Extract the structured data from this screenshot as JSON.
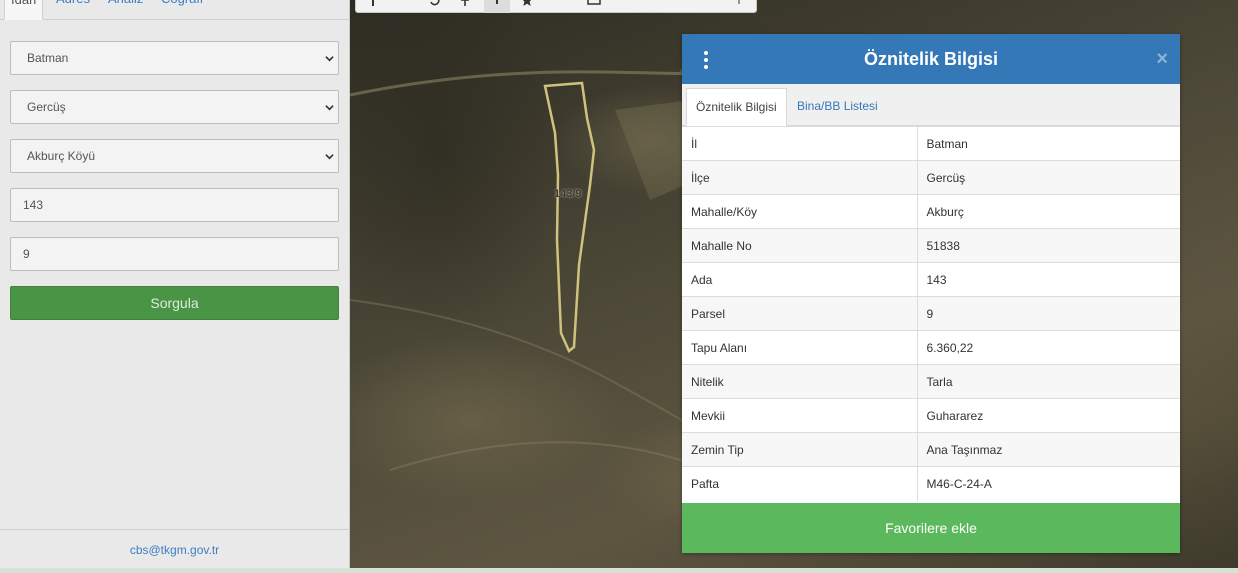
{
  "sidebar": {
    "tabs": [
      {
        "label": "İdari"
      },
      {
        "label": "Adres"
      },
      {
        "label": "Analiz"
      },
      {
        "label": "Coğrafi"
      }
    ],
    "il_select": "Batman",
    "ilce_select": "Gercüş",
    "mahalle_select": "Akburç Köyü",
    "ada_input": "143",
    "parsel_input": "9",
    "query_button": "Sorgula",
    "footer_email": "cbs@tkgm.gov.tr"
  },
  "map": {
    "parcel_label": "143/9",
    "toolbar_icons": [
      "info-icon",
      "refresh-icon",
      "move-icon",
      "pointer-icon",
      "star-icon",
      "separator",
      "print-icon",
      "coordinate-icon",
      "more-icon"
    ]
  },
  "popup": {
    "title": "Öznitelik Bilgisi",
    "tabs": [
      {
        "label": "Öznitelik Bilgisi"
      },
      {
        "label": "Bina/BB Listesi"
      }
    ],
    "rows": [
      {
        "key": "İl",
        "value": "Batman"
      },
      {
        "key": "İlçe",
        "value": "Gercüş"
      },
      {
        "key": "Mahalle/Köy",
        "value": "Akburç"
      },
      {
        "key": "Mahalle No",
        "value": "51838"
      },
      {
        "key": "Ada",
        "value": "143"
      },
      {
        "key": "Parsel",
        "value": "9"
      },
      {
        "key": "Tapu Alanı",
        "value": "6.360,22"
      },
      {
        "key": "Nitelik",
        "value": "Tarla"
      },
      {
        "key": "Mevkii",
        "value": "Guhararez"
      },
      {
        "key": "Zemin Tip",
        "value": "Ana Taşınmaz"
      },
      {
        "key": "Pafta",
        "value": "M46-C-24-A"
      }
    ],
    "favorite_button": "Favorilere ekle"
  },
  "colors": {
    "header": "#3478b7",
    "query_button": "#4a9446",
    "favorite_button": "#5cb85c",
    "link": "#3b7fc4",
    "parcel_outline": "#cfc27e"
  }
}
